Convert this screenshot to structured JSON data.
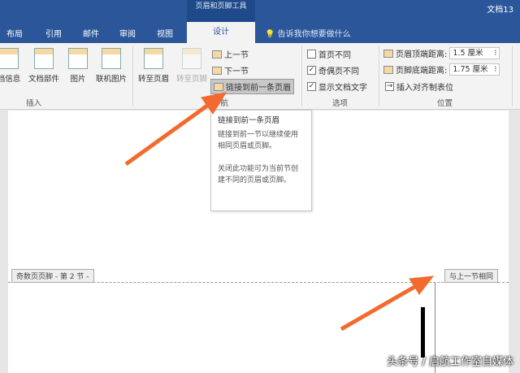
{
  "title_bar": {
    "context_tab": "页眉和页脚工具",
    "document": "文档13"
  },
  "tabs": [
    "布局",
    "引用",
    "邮件",
    "审阅",
    "视图",
    "设计"
  ],
  "tell_me": "告诉我你想要做什么",
  "ribbon": {
    "insert": {
      "buttons": [
        "档信息",
        "文档部件",
        "图片",
        "联机图片"
      ],
      "group": "插入"
    },
    "nav": {
      "goto_header": "转至页眉",
      "goto_footer": "转至页脚",
      "prev": "上一节",
      "next": "下一节",
      "link": "链接到前一条页眉",
      "group": "导航"
    },
    "options": {
      "items": [
        {
          "label": "首页不同",
          "checked": false
        },
        {
          "label": "奇偶页不同",
          "checked": true
        },
        {
          "label": "显示文档文字",
          "checked": true
        }
      ],
      "group": "选项"
    },
    "position": {
      "header_label": "页眉顶端距离:",
      "header_value": "1.5 厘米",
      "footer_label": "页脚底端距离:",
      "footer_value": "1.75 厘米",
      "align_tab": "插入对齐制表位",
      "group": "位置"
    }
  },
  "tooltip": {
    "title": "链接到前一条页眉",
    "line1": "链接到前一节以继续使用相同页眉或页脚。",
    "line2": "关闭此功能可为当前节创建不同的页眉或页脚。"
  },
  "doc": {
    "footer_label": "奇数页页脚 - 第 2 节 -",
    "same_as_prev": "与上一节相同"
  },
  "watermark": "头条号 / 启航工作室自媒体",
  "colors": {
    "brand": "#2b579a",
    "arrow": "#f26a2e"
  }
}
